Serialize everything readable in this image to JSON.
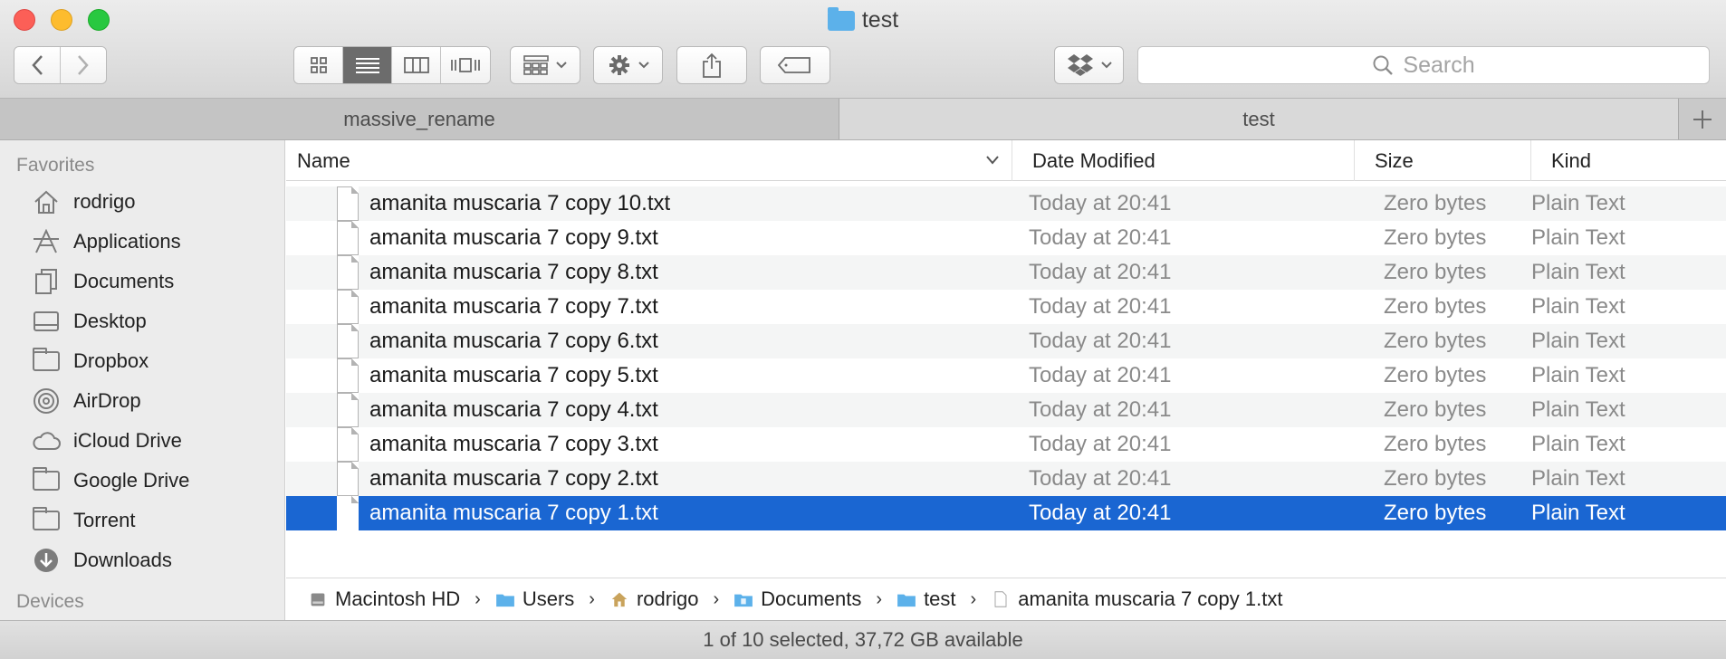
{
  "window": {
    "title": "test"
  },
  "toolbar": {
    "search_placeholder": "Search"
  },
  "tabs": [
    {
      "label": "massive_rename"
    },
    {
      "label": "test"
    }
  ],
  "sidebar": {
    "favorites_heading": "Favorites",
    "items": [
      {
        "label": "rodrigo",
        "icon": "home-icon"
      },
      {
        "label": "Applications",
        "icon": "applications-icon"
      },
      {
        "label": "Documents",
        "icon": "documents-icon"
      },
      {
        "label": "Desktop",
        "icon": "desktop-icon"
      },
      {
        "label": "Dropbox",
        "icon": "folder-icon"
      },
      {
        "label": "AirDrop",
        "icon": "airdrop-icon"
      },
      {
        "label": "iCloud Drive",
        "icon": "cloud-icon"
      },
      {
        "label": "Google Drive",
        "icon": "folder-icon"
      },
      {
        "label": "Torrent",
        "icon": "folder-icon"
      },
      {
        "label": "Downloads",
        "icon": "downloads-icon"
      }
    ],
    "devices_heading": "Devices"
  },
  "columns": {
    "name": "Name",
    "date": "Date Modified",
    "size": "Size",
    "kind": "Kind"
  },
  "files": [
    {
      "name": "amanita muscaria 7 copy 10.txt",
      "date": "Today at 20:41",
      "size": "Zero bytes",
      "kind": "Plain Text"
    },
    {
      "name": "amanita muscaria 7 copy 9.txt",
      "date": "Today at 20:41",
      "size": "Zero bytes",
      "kind": "Plain Text"
    },
    {
      "name": "amanita muscaria 7 copy 8.txt",
      "date": "Today at 20:41",
      "size": "Zero bytes",
      "kind": "Plain Text"
    },
    {
      "name": "amanita muscaria 7 copy 7.txt",
      "date": "Today at 20:41",
      "size": "Zero bytes",
      "kind": "Plain Text"
    },
    {
      "name": "amanita muscaria 7 copy 6.txt",
      "date": "Today at 20:41",
      "size": "Zero bytes",
      "kind": "Plain Text"
    },
    {
      "name": "amanita muscaria 7 copy 5.txt",
      "date": "Today at 20:41",
      "size": "Zero bytes",
      "kind": "Plain Text"
    },
    {
      "name": "amanita muscaria 7 copy 4.txt",
      "date": "Today at 20:41",
      "size": "Zero bytes",
      "kind": "Plain Text"
    },
    {
      "name": "amanita muscaria 7 copy 3.txt",
      "date": "Today at 20:41",
      "size": "Zero bytes",
      "kind": "Plain Text"
    },
    {
      "name": "amanita muscaria 7 copy 2.txt",
      "date": "Today at 20:41",
      "size": "Zero bytes",
      "kind": "Plain Text"
    },
    {
      "name": "amanita muscaria 7 copy 1.txt",
      "date": "Today at 20:41",
      "size": "Zero bytes",
      "kind": "Plain Text"
    }
  ],
  "pathbar": [
    {
      "label": "Macintosh HD",
      "icon": "hard-drive-icon"
    },
    {
      "label": "Users",
      "icon": "folder-icon"
    },
    {
      "label": "rodrigo",
      "icon": "home-icon"
    },
    {
      "label": "Documents",
      "icon": "documents-icon"
    },
    {
      "label": "test",
      "icon": "folder-icon"
    },
    {
      "label": "amanita muscaria 7 copy 1.txt",
      "icon": "text-file-icon"
    }
  ],
  "status": {
    "text": "1 of 10 selected, 37,72 GB available"
  },
  "colors": {
    "selection": "#1a66d2",
    "folder": "#5cb1ea",
    "close": "#fc5f57",
    "minimize": "#fdbc2e",
    "maximize": "#28c840"
  }
}
